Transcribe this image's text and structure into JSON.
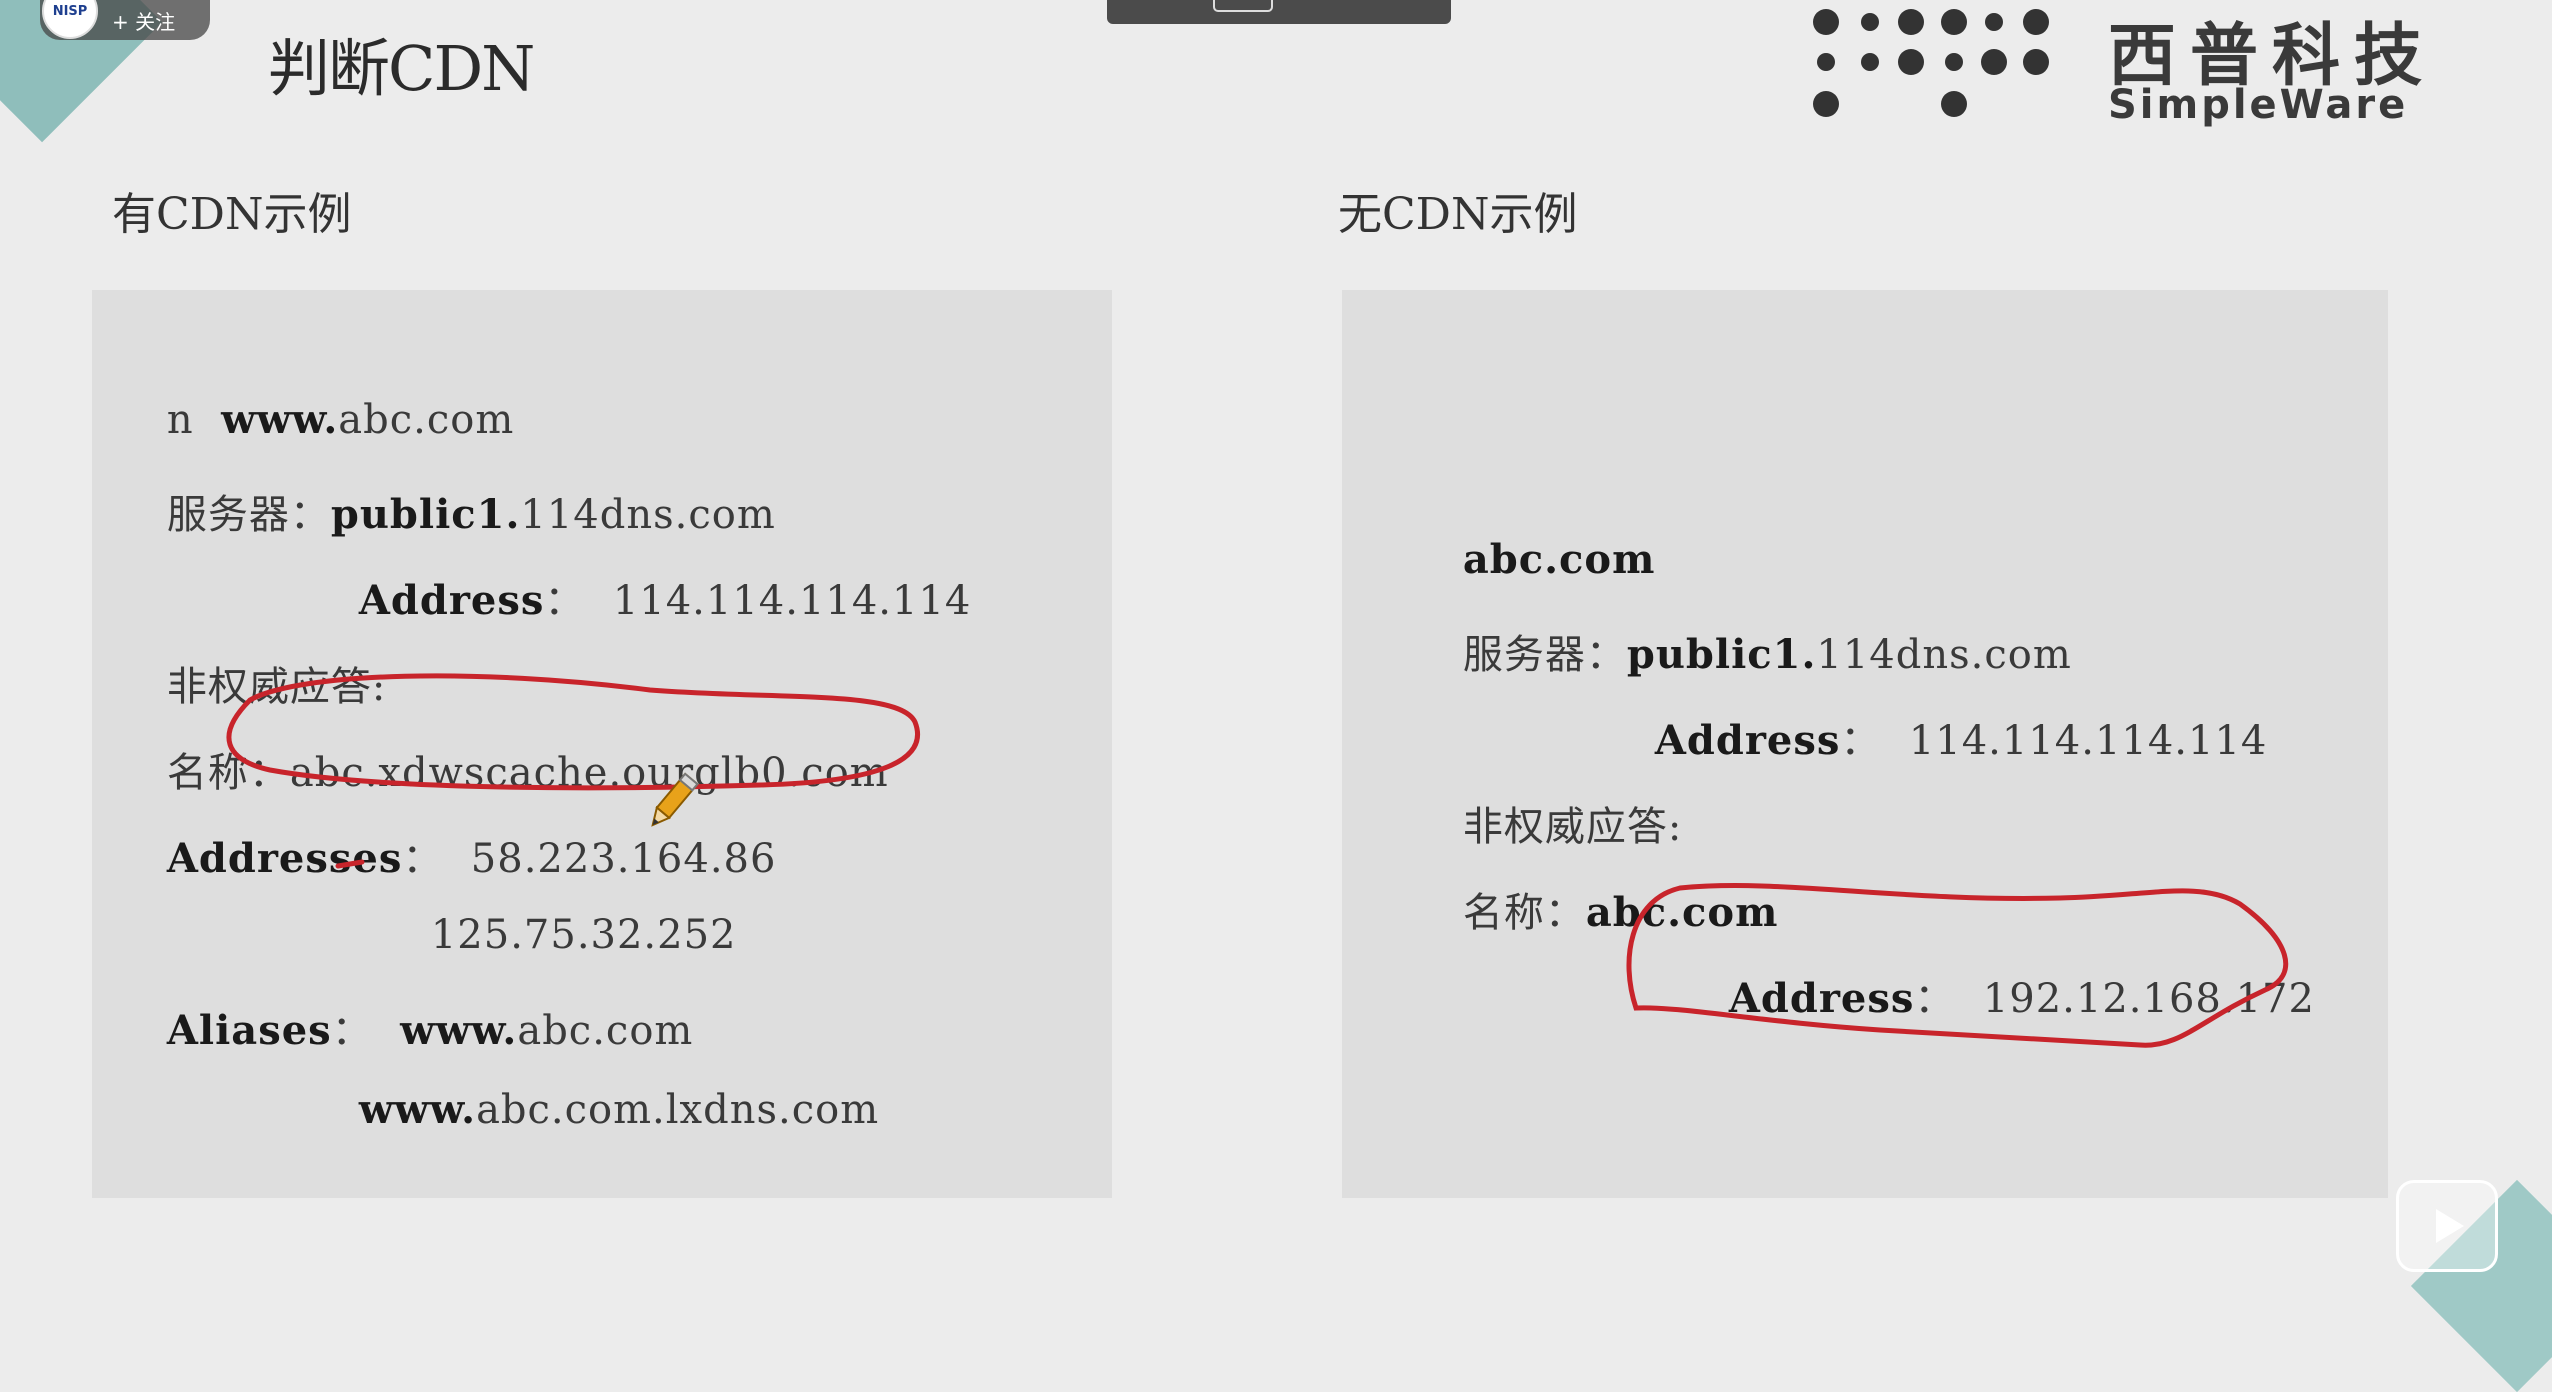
{
  "overlay": {
    "channel_badge": "NISP",
    "follow_label": "+ 关注"
  },
  "slide": {
    "title": "判断CDN",
    "logo": {
      "cn": "西普科技",
      "en": "SimpleWare"
    },
    "left": {
      "heading": "有CDN示例",
      "lines": [
        {
          "label": "n  ",
          "bold": "www.",
          "rest": "abc.com"
        },
        {
          "label": "服务器：",
          "bold": "public1.",
          "rest": "114dns.com"
        },
        {
          "label": "",
          "bold": "Address",
          "rest": "：  114.114.114.114"
        },
        {
          "label": "非权威应答:",
          "bold": "",
          "rest": ""
        },
        {
          "label": "名称：",
          "bold": "",
          "rest": "abc.xdwscache.ourglb0.com"
        },
        {
          "label": "",
          "bold": "Addresses",
          "rest": "：  58.223.164.86"
        },
        {
          "label": "",
          "bold": "",
          "rest": "125.75.32.252"
        },
        {
          "label": "",
          "bold": "Aliases",
          "rest": "：  "
        },
        {
          "label": "",
          "bold": "www.",
          "rest": "abc.com.lxdns.com"
        }
      ],
      "aliases_value_bold": "www.",
      "aliases_value_rest": "abc.com"
    },
    "right": {
      "heading": "无CDN示例",
      "lines": [
        {
          "label": "",
          "bold": "abc.com",
          "rest": ""
        },
        {
          "label": "服务器：",
          "bold": "public1.",
          "rest": "114dns.com"
        },
        {
          "label": "",
          "bold": "Address",
          "rest": "：  114.114.114.114"
        },
        {
          "label": "非权威应答:",
          "bold": "",
          "rest": ""
        },
        {
          "label": "名称：",
          "bold": "abc.com",
          "rest": ""
        },
        {
          "label": "",
          "bold": "Address",
          "rest": "：  192.12.168.172"
        }
      ]
    }
  },
  "colors": {
    "annotation_red": "#c8242b",
    "panel_bg": "#dedede",
    "page_bg": "#ececec",
    "accent_teal": "#7fb6b3"
  },
  "icons": {
    "pencil": "pencil-icon",
    "play": "play-icon"
  }
}
